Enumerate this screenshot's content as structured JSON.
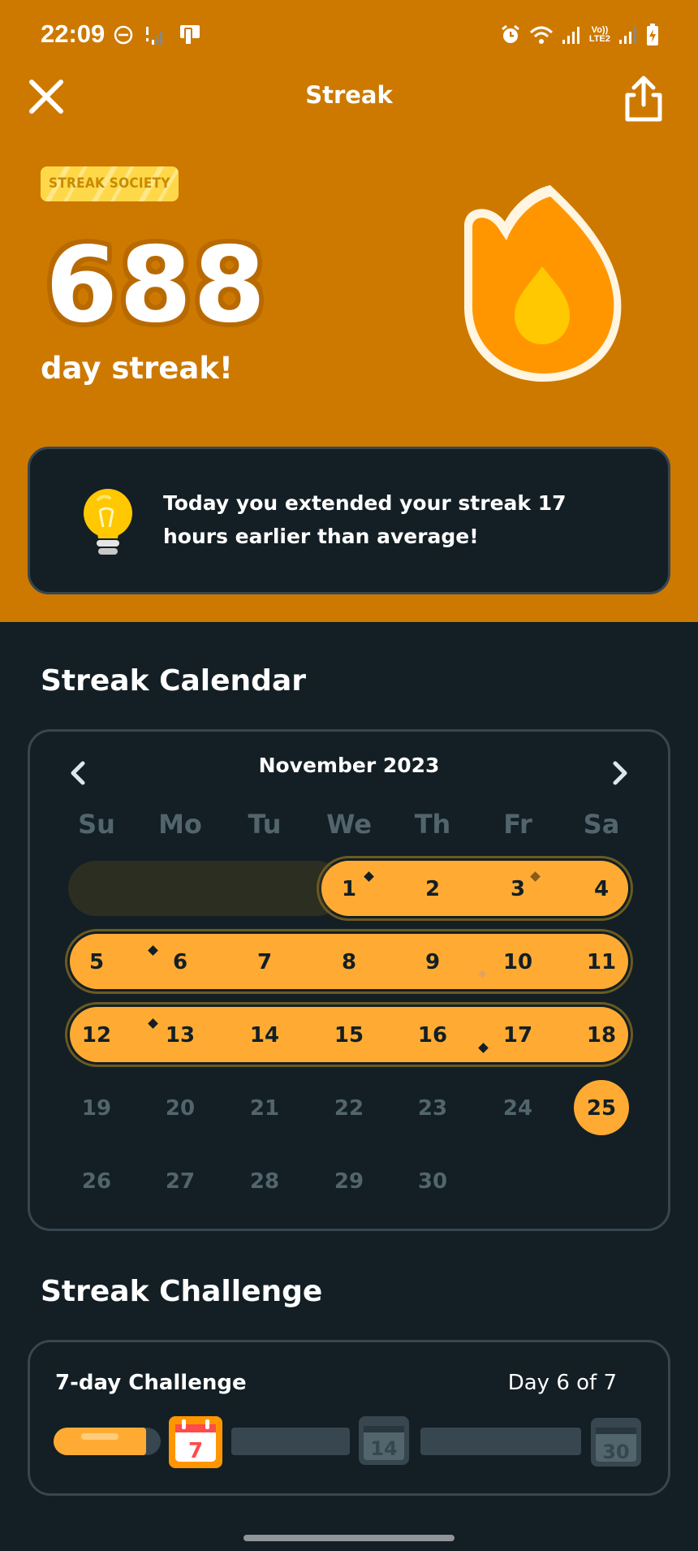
{
  "status_bar": {
    "time": "22:09",
    "network_label": "Vo))\nLTE2"
  },
  "header": {
    "title": "Streak",
    "close_icon": "close-icon",
    "share_icon": "share-icon"
  },
  "streak": {
    "badge": "STREAK SOCIETY",
    "count": "688",
    "label": "day streak!"
  },
  "tip": {
    "icon": "lightbulb-icon",
    "text": "Today you extended your streak 17 hours earlier than average!"
  },
  "calendar": {
    "section_title": "Streak Calendar",
    "month": "November 2023",
    "weekdays": [
      "Su",
      "Mo",
      "Tu",
      "We",
      "Th",
      "Fr",
      "Sa"
    ],
    "days": [
      "1",
      "2",
      "3",
      "4",
      "5",
      "6",
      "7",
      "8",
      "9",
      "10",
      "11",
      "12",
      "13",
      "14",
      "15",
      "16",
      "17",
      "18",
      "19",
      "20",
      "21",
      "22",
      "23",
      "24",
      "25",
      "26",
      "27",
      "28",
      "29",
      "30"
    ],
    "streak_days": "1-25",
    "today": "25"
  },
  "challenge": {
    "section_title": "Streak Challenge",
    "title": "7-day Challenge",
    "progress": "Day 6 of 7",
    "progress_value": 0.857,
    "milestones": [
      "7",
      "14",
      "30"
    ]
  },
  "colors": {
    "header_bg": "#cd7900",
    "accent": "#ffab33",
    "background": "#131f24",
    "border": "#37464f",
    "muted_text": "#52656d"
  }
}
